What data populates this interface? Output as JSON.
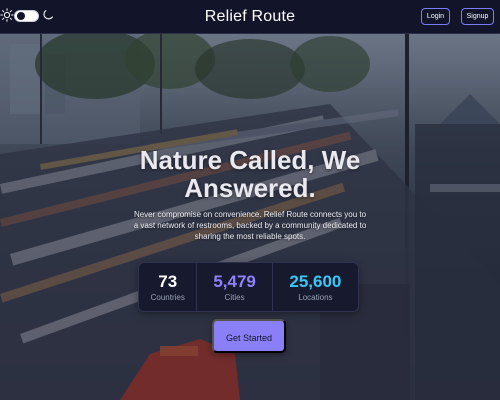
{
  "header": {
    "title": "Relief Route",
    "login_label": "Login",
    "signup_label": "Signup",
    "theme_toggle": {
      "left_icon": "sun-icon",
      "right_icon": "moon-icon",
      "state": "dark"
    }
  },
  "hero": {
    "headline_line1": "Nature Called, We",
    "headline_line2": "Answered.",
    "subtext": "Never compromise on convenience. Relief Route connects you to a vast network of restrooms, backed by a community dedicated to sharing the most reliable spots.",
    "cta_label": "Get Started"
  },
  "stats": [
    {
      "value": "73",
      "label": "Countries",
      "color": "#ffffff"
    },
    {
      "value": "5,479",
      "label": "Cities",
      "color": "#8f82ff"
    },
    {
      "value": "25,600",
      "label": "Locations",
      "color": "#38c8f5"
    }
  ],
  "colors": {
    "header_bg": "#12152a",
    "accent": "#8b7ff7",
    "button_border": "#7d7bff"
  }
}
